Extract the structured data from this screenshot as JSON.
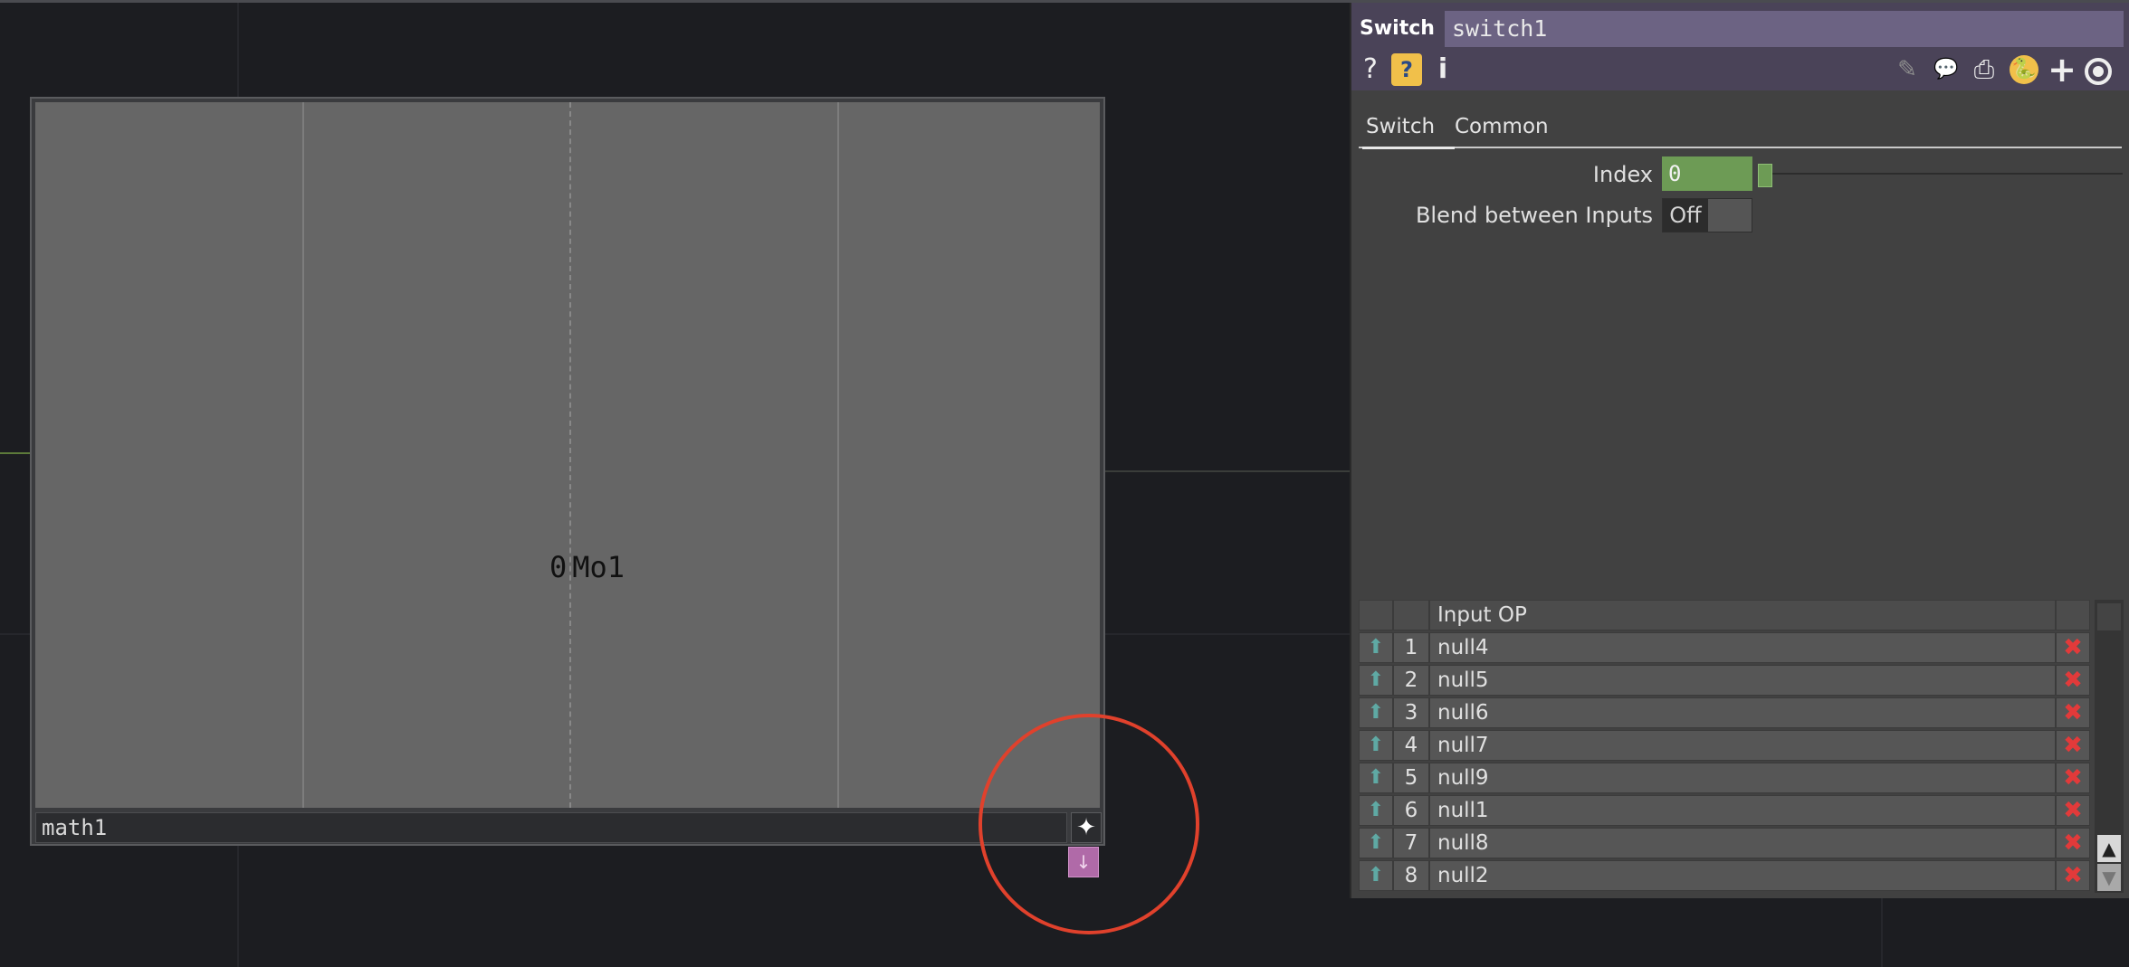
{
  "node": {
    "name": "math1",
    "channel_value": "0",
    "channel_name": "Mo1",
    "viewer_button_icon": "✦",
    "flag_button_icon": "↓"
  },
  "panel": {
    "op_type": "Switch",
    "op_name": "switch1",
    "header_icons": {
      "help": "?",
      "python_help": "?",
      "info": "i",
      "edit": "✎",
      "comment": "💬",
      "docked": "⎙",
      "python": "🐍",
      "add": "+",
      "target": ""
    },
    "tabs": [
      {
        "label": "Switch",
        "active": true
      },
      {
        "label": "Common",
        "active": false
      }
    ],
    "params": {
      "index_label": "Index",
      "index_value": "0",
      "blend_label": "Blend between Inputs",
      "blend_value": "Off"
    },
    "table": {
      "header": "Input OP",
      "rows": [
        {
          "num": "1",
          "op": "null4"
        },
        {
          "num": "2",
          "op": "null5"
        },
        {
          "num": "3",
          "op": "null6"
        },
        {
          "num": "4",
          "op": "null7"
        },
        {
          "num": "5",
          "op": "null9"
        },
        {
          "num": "6",
          "op": "null1"
        },
        {
          "num": "7",
          "op": "null8"
        },
        {
          "num": "8",
          "op": "null2"
        }
      ],
      "arrow_glyph": "⬆",
      "delete_glyph": "✖"
    },
    "scroll": {
      "up": "▲",
      "down": "▼"
    }
  }
}
